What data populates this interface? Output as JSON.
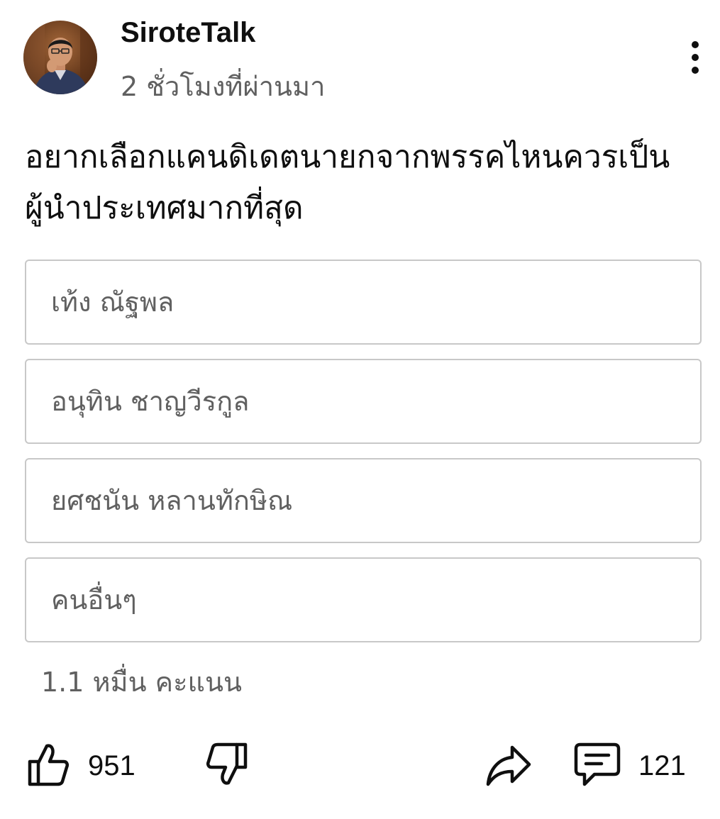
{
  "post": {
    "channel_name": "SiroteTalk",
    "time": "2 ชั่วโมงที่ผ่านมา",
    "avatar_icon": "channel-avatar",
    "more_icon": "vertical-ellipsis-icon"
  },
  "poll": {
    "question": "อยากเลือกแคนดิเดตนายกจากพรรคไหนควรเป็นผู้นำประเทศมากที่สุด",
    "options": [
      {
        "label": "เท้ง ณัฐพล"
      },
      {
        "label": "อนุทิน ชาญวีรกูล"
      },
      {
        "label": "ยศชนัน หลานทักษิณ"
      },
      {
        "label": "คนอื่นๆ"
      }
    ],
    "votes": "1.1 หมื่น คะแนน"
  },
  "actions": {
    "like_icon": "thumbs-up-icon",
    "like_count": "951",
    "dislike_icon": "thumbs-down-icon",
    "share_icon": "share-icon",
    "comment_icon": "comment-icon",
    "comment_count": "121"
  },
  "colors": {
    "text_primary": "#0f0f0f",
    "text_secondary": "#606060",
    "option_border": "#c8c8c8",
    "background": "#ffffff"
  }
}
